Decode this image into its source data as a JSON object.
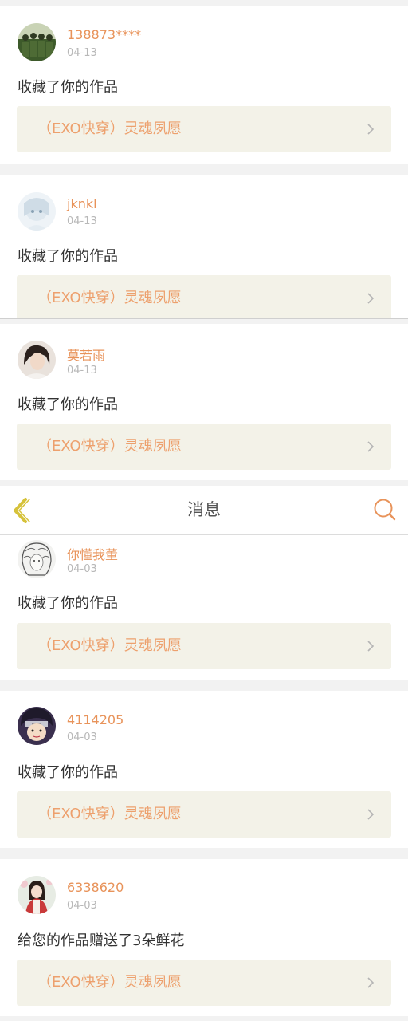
{
  "header": {
    "title": "消息",
    "back_icon": "chevron-left-icon",
    "search_icon": "search-icon",
    "back_color": "#d6c23a",
    "search_color": "#e8935a"
  },
  "colors": {
    "accent": "#e8935a",
    "work_bg": "#f3f2e8",
    "work_text": "#eda06d",
    "date_text": "#b8b8b8"
  },
  "notifications": [
    {
      "username": "138873****",
      "date": "04-13",
      "action": "收藏了你的作品",
      "work_title": "（EXO快穿）灵魂夙愿"
    },
    {
      "username": "jknkl",
      "date": "04-13",
      "action": "收藏了你的作品",
      "work_title": "（EXO快穿）灵魂夙愿"
    },
    {
      "username": "莫若雨",
      "date": "04-13",
      "action": "收藏了你的作品",
      "work_title": "（EXO快穿）灵魂夙愿"
    },
    {
      "username": "你懂我董",
      "date": "04-03",
      "action": "收藏了你的作品",
      "work_title": "（EXO快穿）灵魂夙愿"
    },
    {
      "username": "4114205",
      "date": "04-03",
      "action": "收藏了你的作品",
      "work_title": "（EXO快穿）灵魂夙愿"
    },
    {
      "username": "6338620",
      "date": "04-03",
      "action": "给您的作品赠送了3朵鲜花",
      "work_title": "（EXO快穿）灵魂夙愿"
    }
  ]
}
